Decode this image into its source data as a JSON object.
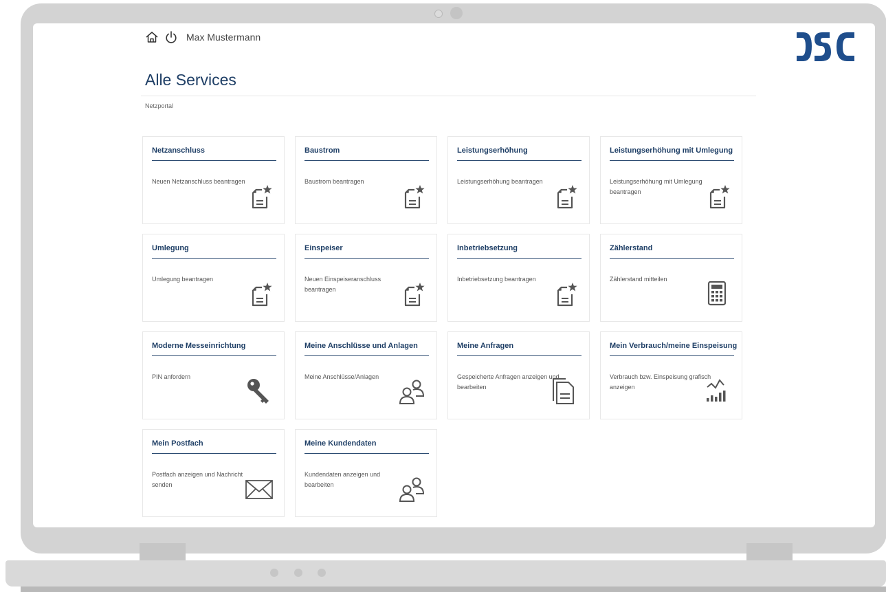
{
  "header": {
    "user_name": "Max Mustermann",
    "home_icon": "home-icon",
    "power_icon": "power-icon",
    "logo_icon": "brand-logo"
  },
  "page": {
    "title": "Alle Services",
    "breadcrumb": "Netzportal"
  },
  "colors": {
    "title": "#1f3f66",
    "logo": "#1f4e8c",
    "icon": "#555555"
  },
  "tiles": [
    {
      "title": "Netzanschluss",
      "description": "Neuen Netzanschluss beantragen",
      "icon": "document-star-icon"
    },
    {
      "title": "Baustrom",
      "description": "Baustrom beantragen",
      "icon": "document-star-icon"
    },
    {
      "title": "Leistungserhöhung",
      "description": "Leistungserhöhung beantragen",
      "icon": "document-star-icon"
    },
    {
      "title": "Leistungserhöhung mit Umlegung",
      "description": "Leistungserhöhung mit Umlegung beantragen",
      "icon": "document-star-icon"
    },
    {
      "title": "Umlegung",
      "description": "Umlegung beantragen",
      "icon": "document-star-icon"
    },
    {
      "title": "Einspeiser",
      "description": "Neuen Einspeiseranschluss beantragen",
      "icon": "document-star-icon"
    },
    {
      "title": "Inbetriebsetzung",
      "description": "Inbetriebsetzung beantragen",
      "icon": "document-star-icon"
    },
    {
      "title": "Zählerstand",
      "description": "Zählerstand mitteilen",
      "icon": "calculator-icon"
    },
    {
      "title": "Moderne Messeinrichtung",
      "description": "PIN anfordern",
      "icon": "key-icon"
    },
    {
      "title": "Meine Anschlüsse und Anlagen",
      "description": "Meine Anschlüsse/Anlagen",
      "icon": "users-icon"
    },
    {
      "title": "Meine Anfragen",
      "description": "Gespeicherte Anfragen anzeigen und bearbeiten",
      "icon": "documents-icon"
    },
    {
      "title": "Mein Verbrauch/meine Einspeisung",
      "description": "Verbrauch bzw. Einspeisung grafisch anzeigen",
      "icon": "chart-icon"
    },
    {
      "title": "Mein Postfach",
      "description": "Postfach anzeigen und Nachricht senden",
      "icon": "envelope-icon"
    },
    {
      "title": "Meine Kundendaten",
      "description": "Kundendaten anzeigen und bearbeiten",
      "icon": "users-icon"
    }
  ]
}
